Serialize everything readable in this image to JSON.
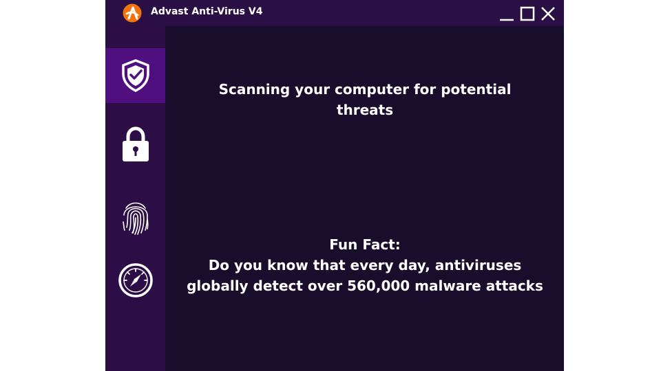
{
  "window": {
    "title": "Advast Anti-Virus V4",
    "logo_icon": "advast-logo-icon",
    "controls": [
      "minimize-icon",
      "maximize-icon",
      "close-icon"
    ]
  },
  "sidebar": {
    "items": [
      {
        "icon": "shield-check-icon",
        "active": true
      },
      {
        "icon": "lock-icon",
        "active": false
      },
      {
        "icon": "fingerprint-icon",
        "active": false
      },
      {
        "icon": "speedometer-icon",
        "active": false
      }
    ]
  },
  "main": {
    "status_text": "Scanning your computer for potential threats",
    "fun_fact_heading": "Fun Fact:",
    "fun_fact_body": "Do you know that every day, antiviruses globally detect over 560,000 malware attacks"
  },
  "colors": {
    "titlebar": "#2a0f45",
    "sidebar": "#2c0d45",
    "sidebar_active": "#4f0f7f",
    "content_bg": "#190d2c",
    "logo_orange": "#f2720c",
    "text": "#ffffff"
  }
}
